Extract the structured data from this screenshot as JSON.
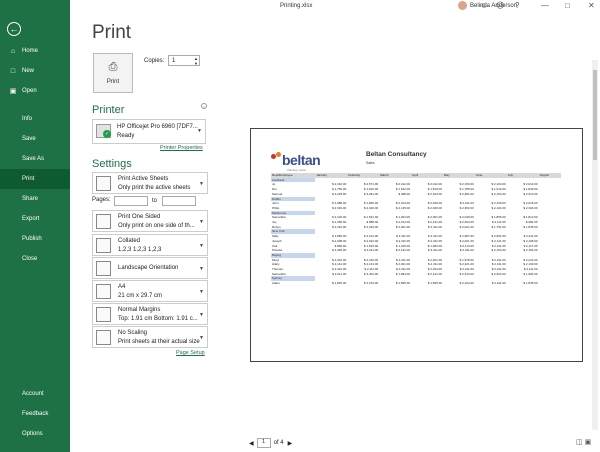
{
  "window": {
    "title": "Printing.xlsx",
    "user": "Belinda Anderson"
  },
  "sidebar": {
    "back_icon": "arrow-left-icon",
    "items": [
      {
        "label": "Home",
        "icon": "home-icon"
      },
      {
        "label": "New",
        "icon": "new-doc-icon"
      },
      {
        "label": "Open",
        "icon": "folder-icon"
      },
      {
        "label": "Info",
        "icon": ""
      },
      {
        "label": "Save",
        "icon": ""
      },
      {
        "label": "Save As",
        "icon": ""
      },
      {
        "label": "Print",
        "icon": ""
      },
      {
        "label": "Share",
        "icon": ""
      },
      {
        "label": "Export",
        "icon": ""
      },
      {
        "label": "Publish",
        "icon": ""
      },
      {
        "label": "Close",
        "icon": ""
      },
      {
        "label": "Account",
        "icon": ""
      },
      {
        "label": "Feedback",
        "icon": ""
      },
      {
        "label": "Options",
        "icon": ""
      }
    ],
    "active": "Print",
    "accent": "#1e7145"
  },
  "print_panel": {
    "title": "Print",
    "print_button_label": "Print",
    "copies_label": "Copies:",
    "copies_value": "1"
  },
  "printer": {
    "heading": "Printer",
    "name": "HP Officejet Pro 6960 [7DF7...",
    "status": "Ready",
    "properties_link": "Printer Properties"
  },
  "settings": {
    "heading": "Settings",
    "active_sheets": {
      "l1": "Print Active Sheets",
      "l2": "Only print the active sheets"
    },
    "pages_label": "Pages:",
    "to_label": "to",
    "sides": {
      "l1": "Print One Sided",
      "l2": "Only print on one side of th..."
    },
    "collate": {
      "l1": "Collated",
      "l2": "1,2,3    1,2,3    1,2,3"
    },
    "orientation": {
      "l1": "Landscape Orientation"
    },
    "paper": {
      "l1": "A4",
      "l2": "21 cm x 29.7 cm"
    },
    "margins": {
      "l1": "Normal Margins",
      "l2": "Top: 1.91 cm Bottom: 1.91 c..."
    },
    "scaling": {
      "l1": "No Scaling",
      "l2": "Print sheets at their actual size"
    },
    "page_setup_link": "Page Setup"
  },
  "preview": {
    "logo_text": "beltan",
    "logo_tag": "training | www",
    "company": "Beltan Consultancy",
    "subtitle": "Sales",
    "columns": [
      "Dept/Employee",
      "January",
      "February",
      "March",
      "April",
      "May",
      "June",
      "July",
      "August"
    ],
    "groups": [
      {
        "city": "Auckland",
        "rows": [
          [
            "Jo",
            "2,310.00",
            "2,571.00",
            "2,312.00",
            "2,012.00",
            "2,150.00",
            "2,104.00",
            "2,014.00"
          ],
          [
            "Nio",
            "1,750.00",
            "1,812.00",
            "1,512.00",
            "1,519.00",
            "1,785.00",
            "1,512.00",
            "1,839.00"
          ],
          [
            "Samuel",
            "2,218.00",
            "2,061.00",
            "498.00",
            "2,103.00",
            "2,481.00",
            "2,154.00",
            "2,310.00"
          ]
        ]
      },
      {
        "city": "Dubbo",
        "rows": [
          [
            "John",
            "1,986.00",
            "1,845.00",
            "2,314.00",
            "2,040.00",
            "2,411.00",
            "2,109.00",
            "2,015.00"
          ],
          [
            "Philip",
            "2,334.00",
            "2,010.00",
            "2,145.00",
            "2,046.00",
            "2,352.00",
            "2,101.00",
            "2,304.00"
          ]
        ]
      },
      {
        "city": "Melbourne",
        "rows": [
          [
            "Samantha",
            "2,104.00",
            "1,531.00",
            "1,204.00",
            "2,001.00",
            "2,049.00",
            "1,856.00",
            "1,812.00"
          ],
          [
            "Joy",
            "2,356.00",
            "888.00",
            "2,154.00",
            "2,131.00",
            "2,354.00",
            "2,111.00",
            "984.00"
          ],
          [
            "Robyn",
            "2,310.00",
            "2,310.00",
            "2,021.00",
            "2,311.00",
            "2,021.00",
            "1,751.00",
            "1,845.00"
          ]
        ]
      },
      {
        "city": "New York",
        "rows": [
          [
            "Sally",
            "1,866.00",
            "2,101.00",
            "2,311.00",
            "2,311.00",
            "1,987.00",
            "2,051.00",
            "2,411.00"
          ],
          [
            "Joseph",
            "2,008.00",
            "2,012.00",
            "2,311.00",
            "2,311.00",
            "2,021.00",
            "2,121.00",
            "2,105.00"
          ],
          [
            "Cait",
            "890.00",
            "1,534.00",
            "1,015.00",
            "1,084.00",
            "2,114.00",
            "2,311.00",
            "2,117.00"
          ],
          [
            "Phoebe",
            "2,345.00",
            "2,011.00",
            "2,131.00",
            "2,311.00",
            "2,311.00",
            "2,154.00",
            "2,154.00"
          ]
        ]
      },
      {
        "city": "Beijing",
        "rows": [
          [
            "Minyi",
            "2,301.00",
            "2,310.00",
            "2,311.00",
            "2,401.00",
            "1,978.00",
            "2,311.00",
            "2,214.00"
          ],
          [
            "Hilary",
            "2,141.00",
            "2,131.00",
            "2,021.00",
            "2,311.00",
            "2,321.00",
            "2,311.00",
            "2,103.00"
          ],
          [
            "Thomas",
            "2,310.00",
            "2,111.00",
            "2,311.00",
            "2,334.00",
            "2,211.00",
            "2,311.00",
            "2,111.00"
          ],
          [
            "Samantha",
            "2,211.00",
            "2,301.00",
            "1,994.00",
            "2,141.00",
            "2,310.00",
            "2,324.00",
            "1,994.00"
          ]
        ]
      },
      {
        "city": "Sydney",
        "rows": [
          [
            "Adam",
            "1,845.00",
            "2,154.00",
            "1,845.00",
            "1,845.00",
            "2,104.00",
            "2,311.00",
            "1,845.00"
          ]
        ]
      }
    ]
  },
  "navigation": {
    "current_page": "1",
    "total_pages": "of 4"
  }
}
